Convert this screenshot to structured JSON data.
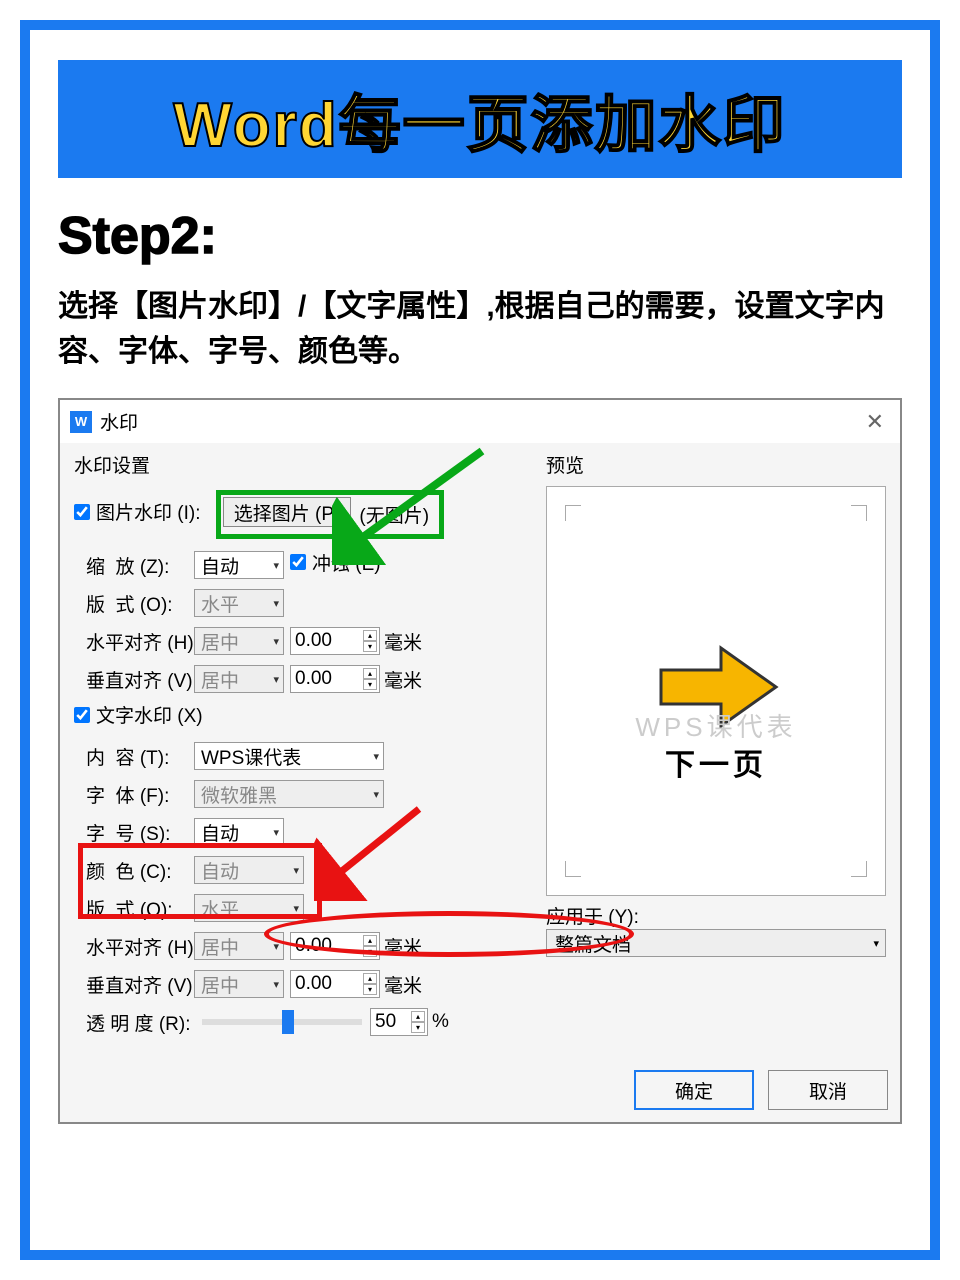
{
  "banner": "Word每一页添加水印",
  "step_label": "Step2:",
  "step_desc": "选择【图片水印】/【文字属性】,根据自己的需要，设置文字内容、字体、字号、颜色等。",
  "dialog": {
    "title": "水印",
    "icon_letter": "W",
    "group": "水印设置",
    "pic_check": "图片水印 (I):",
    "select_pic_btn": "选择图片 (P)",
    "no_pic": "(无图片)",
    "scale_label": "缩  放 (Z):",
    "scale_value": "自动",
    "washout": "冲蚀 (E)",
    "layout_label": "版  式 (O):",
    "layout_value": "水平",
    "halign_label": "水平对齐 (H):",
    "halign_value": "居中",
    "halign_num": "0.00",
    "unit_mm": "毫米",
    "valign_label": "垂直对齐 (V):",
    "valign_value": "居中",
    "valign_num": "0.00",
    "text_check": "文字水印 (X)",
    "content_label": "内  容 (T):",
    "content_value": "WPS课代表",
    "font_label": "字  体 (F):",
    "font_value": "微软雅黑",
    "size_label": "字  号 (S):",
    "size_value": "自动",
    "color_label": "颜  色 (C):",
    "color_value": "自动",
    "layout2_label": "版  式 (O):",
    "layout2_value": "水平",
    "halign2_label": "水平对齐 (H):",
    "halign2_value": "居中",
    "halign2_num": "0.00",
    "valign2_label": "垂直对齐 (V):",
    "valign2_value": "居中",
    "valign2_num": "0.00",
    "opacity_label": "透 明 度 (R):",
    "opacity_value": "50",
    "opacity_pct": "%",
    "preview_label": "预览",
    "watermark_preview": "WPS课代表",
    "next_page": "下一页",
    "apply_label": "应用于 (Y):",
    "apply_value": "整篇文档",
    "ok": "确定",
    "cancel": "取消"
  }
}
